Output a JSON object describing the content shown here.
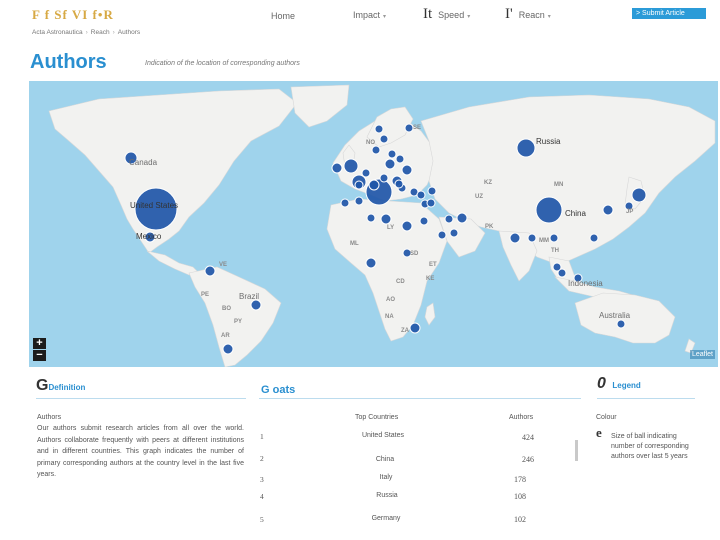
{
  "header": {
    "logo": "F f  Sf  VI f•R",
    "nav": {
      "home": "Home",
      "impact": "Impact",
      "speed_glyph": "It",
      "speed": "Speed",
      "reach_glyph": "I'",
      "reach": "Reacn"
    },
    "submit_label": "> Submit Article"
  },
  "breadcrumb": {
    "journal": "Acta Astronautica",
    "section": "Reach",
    "page": "Authors"
  },
  "page": {
    "title": "Authors",
    "subtitle": "Indication of the location of corresponding authors"
  },
  "map": {
    "zoom_in": "+",
    "zoom_out": "−",
    "attribution": "Leaflet",
    "ocean_color": "#9fd3ec",
    "land_color": "#f2f2f0",
    "bubble_color": "#1f56a8",
    "labels": {
      "canada": "Canada",
      "usa": "United States",
      "mexico": "Mexico",
      "ve": "VE",
      "pe": "PE",
      "brazil": "Brazil",
      "bo": "BO",
      "py": "PY",
      "ar": "AR",
      "se": "SE",
      "no": "NO",
      "russia": "Russia",
      "kz": "KZ",
      "mn": "MN",
      "uz": "UZ",
      "china": "China",
      "jp": "JP",
      "pk": "PK",
      "mm": "MM",
      "th": "TH",
      "indonesia": "Indonesia",
      "australia": "Australia",
      "ly": "LY",
      "ml": "ML",
      "sd": "SD",
      "et": "ET",
      "cd": "CD",
      "ke": "KE",
      "ao": "AO",
      "na": "NA",
      "za": "ZA"
    }
  },
  "definition": {
    "letter": "G",
    "heading": "Definition",
    "title": "Authors",
    "text": "Our authors submit research articles from all over the world. Authors collaborate frequently with peers at different institutions and in different countries. This graph indicates the number of primary corresponding authors at the country level in the last five years."
  },
  "goals": {
    "heading": "G oats",
    "col_country": "Top Countries",
    "col_authors": "Authors",
    "rows": [
      {
        "rank": "1",
        "country": "United States",
        "authors": "424"
      },
      {
        "rank": "2",
        "country": "China",
        "authors": "246"
      },
      {
        "rank": "3",
        "country": "Italy",
        "authors": "178"
      },
      {
        "rank": "4",
        "country": "Russia",
        "authors": "108"
      },
      {
        "rank": "5",
        "country": "Germany",
        "authors": "102"
      }
    ]
  },
  "legend": {
    "letter": "0",
    "heading": "Legend",
    "colour_label": "Colour",
    "glyph": "e",
    "text": "Size of ball indicating number of corresponding authors over last 5 years"
  }
}
